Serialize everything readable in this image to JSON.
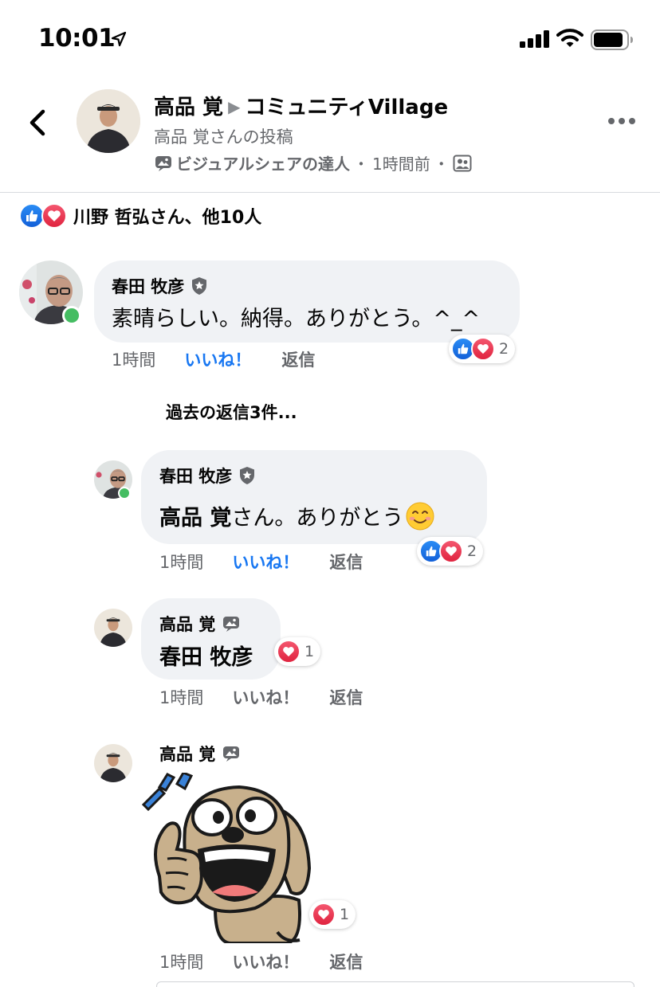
{
  "status_bar": {
    "time": "10:01"
  },
  "header": {
    "author": "高品 覚",
    "group": "コミュニティVillage",
    "subtitle": "高品 覚さんの投稿",
    "badge": "ビジュアルシェアの達人",
    "time": "1時間前",
    "separator": "・"
  },
  "reactions_summary": {
    "text": "川野 哲弘さん、他10人"
  },
  "comments": [
    {
      "author": "春田 牧彦",
      "text": "素晴らしい。納得。ありがとう。^_^",
      "time": "1時間",
      "like_label": "いいね！",
      "reply_label": "返信",
      "reaction_count": "2"
    }
  ],
  "previous_replies": "過去の返信3件...",
  "replies": [
    {
      "author": "春田 牧彦",
      "mention": "高品 覚",
      "text": " さん。ありがとう",
      "emoji": "😊",
      "time": "1時間",
      "like_label": "いいね！",
      "reply_label": "返信",
      "reaction_count": "2"
    },
    {
      "author": "高品 覚",
      "mention": "春田 牧彦",
      "time": "1時間",
      "like_label": "いいね！",
      "reply_label": "返信",
      "reaction_count": "1"
    },
    {
      "author": "高品 覚",
      "time": "1時間",
      "like_label": "いいね！",
      "reply_label": "返信",
      "reaction_count": "1"
    }
  ],
  "colors": {
    "like_blue": "#1877f2",
    "love_red": "#e0243f",
    "bubble_grey": "#f0f2f5",
    "secondary_text": "#65676b",
    "online_green": "#45bd62"
  }
}
